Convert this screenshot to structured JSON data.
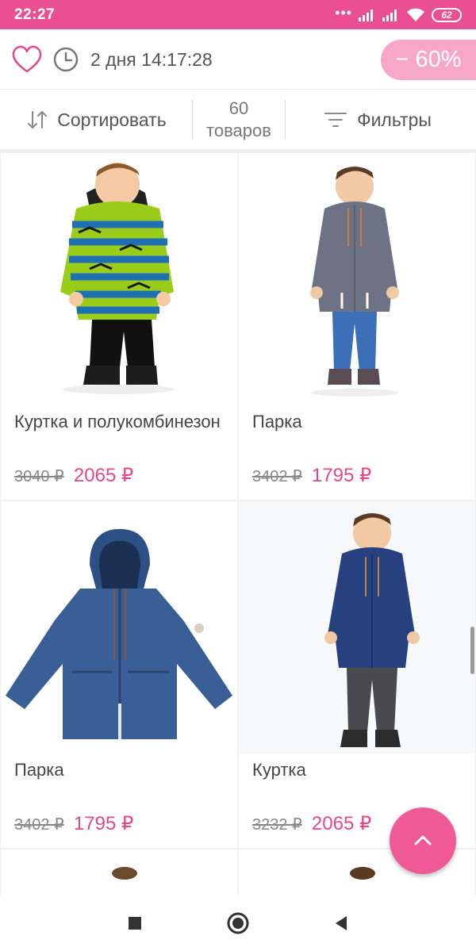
{
  "status_bar": {
    "time": "22:27",
    "battery": "62"
  },
  "header": {
    "timer": "2 дня 14:17:28",
    "discount": "− 60%"
  },
  "controls": {
    "sort_label": "Сортировать",
    "count_number": "60",
    "count_unit": "товаров",
    "filter_label": "Фильтры"
  },
  "products": [
    {
      "name": "Куртка и полукомбинезон",
      "old_price": "3040 ₽",
      "new_price": "2065 ₽"
    },
    {
      "name": "Парка",
      "old_price": "3402 ₽",
      "new_price": "1795 ₽"
    },
    {
      "name": "Парка",
      "old_price": "3402 ₽",
      "new_price": "1795 ₽"
    },
    {
      "name": "Куртка",
      "old_price": "3232 ₽",
      "new_price": "2065 ₽"
    }
  ],
  "colors": {
    "accent": "#ea4f91",
    "price": "#e4478a",
    "badge": "#f7a8c9"
  },
  "icons": [
    "heart-icon",
    "clock-icon",
    "sort-icon",
    "filter-icon",
    "chevron-up-icon",
    "nav-back-icon",
    "nav-home-icon",
    "nav-recents-icon"
  ]
}
